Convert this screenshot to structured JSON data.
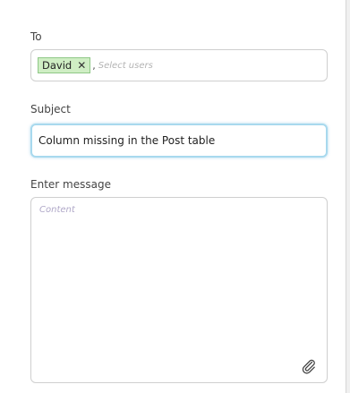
{
  "to": {
    "label": "To",
    "chips": [
      {
        "label": "David",
        "remove_icon": "close-icon"
      }
    ],
    "separator": ",",
    "placeholder": "Select users"
  },
  "subject": {
    "label": "Subject",
    "value": "Column missing in the Post table"
  },
  "message": {
    "label": "Enter message",
    "placeholder": "Content",
    "value": "",
    "attach_icon": "paperclip-icon"
  },
  "colors": {
    "chip_background": "#cfeec4",
    "chip_border": "#8fc887",
    "focus_border": "#a8d9ee"
  }
}
